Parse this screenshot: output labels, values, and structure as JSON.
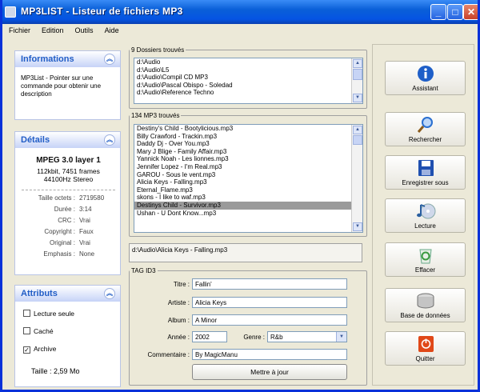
{
  "window": {
    "title": "MP3LIST - Listeur de fichiers MP3",
    "min": "_",
    "max": "□",
    "close": "✕"
  },
  "menu": [
    "Fichier",
    "Edition",
    "Outils",
    "Aide"
  ],
  "info": {
    "title": "Informations",
    "text": "MP3List - Pointer sur une commande pour obtenir une description"
  },
  "details": {
    "title": "Détails",
    "format": "MPEG 3.0 layer 1",
    "rate": "112kbit, 7451 frames",
    "freq": "44100Hz Stereo",
    "fields": [
      {
        "k": "Taille octets :",
        "v": "2719580"
      },
      {
        "k": "Durée :",
        "v": "3:14"
      },
      {
        "k": "CRC :",
        "v": "Vrai"
      },
      {
        "k": "Copyright :",
        "v": "Faux"
      },
      {
        "k": "Original :",
        "v": "Vrai"
      },
      {
        "k": "Emphasis :",
        "v": "None"
      }
    ]
  },
  "attributes": {
    "title": "Attributs",
    "read_only": "Lecture seule",
    "read_only_checked": false,
    "hidden": "Caché",
    "hidden_checked": false,
    "archive": "Archive",
    "archive_checked": true,
    "size": "Taille : 2,59 Mo"
  },
  "folders": {
    "legend": "9 Dossiers trouvés",
    "items": [
      "d:\\Audio",
      "d:\\Audio\\L5",
      "d:\\Audio\\Compil CD MP3",
      "d:\\Audio\\Pascal Obispo - Soledad",
      "d:\\Audio\\Reference Techno"
    ]
  },
  "mp3": {
    "legend": "134 MP3 trouvés",
    "selected_index": 10,
    "items": [
      "Destiny's Child - Bootylicious.mp3",
      "Billy Crawford - Trackin.mp3",
      "Daddy Dj - Over You.mp3",
      "Mary J Blige - Family Affair.mp3",
      "Yannick Noah - Les lionnes.mp3",
      "Jennifer Lopez - I'm Real.mp3",
      "GAROU - Sous le vent.mp3",
      "Alicia Keys - Falling.mp3",
      "Eternal_Flame.mp3",
      "skons - I like to waf.mp3",
      "Destinys Child - Survivor.mp3",
      "Ushan - U Dont Know...mp3"
    ]
  },
  "path": "d:\\Audio\\Alicia Keys - Falling.mp3",
  "tag": {
    "legend": "TAG ID3",
    "title_label": "Titre :",
    "title": "Fallin'",
    "artist_label": "Artiste :",
    "artist": "Alicia Keys",
    "album_label": "Album :",
    "album": "A Minor",
    "year_label": "Année :",
    "year": "2002",
    "genre_label": "Genre :",
    "genre": "R&b",
    "comment_label": "Commentaire :",
    "comment": "By MagicManu",
    "update": "Mettre à jour"
  },
  "actions": [
    {
      "label": "Assistant",
      "icon": "info-icon",
      "color": "#1f5fc8"
    },
    {
      "label": "Rechercher",
      "icon": "search-icon",
      "color": "#2a6fd0"
    },
    {
      "label": "Enregistrer sous",
      "icon": "floppy-icon",
      "color": "#2050b0"
    },
    {
      "label": "Lecture",
      "icon": "music-icon",
      "color": "#2a5fa0"
    },
    {
      "label": "Effacer",
      "icon": "recycle-bin-icon",
      "color": "#3a9a40"
    },
    {
      "label": "Base de données",
      "icon": "database-icon",
      "color": "#707070"
    },
    {
      "label": "Quitter",
      "icon": "exit-icon",
      "color": "#e04818"
    }
  ]
}
